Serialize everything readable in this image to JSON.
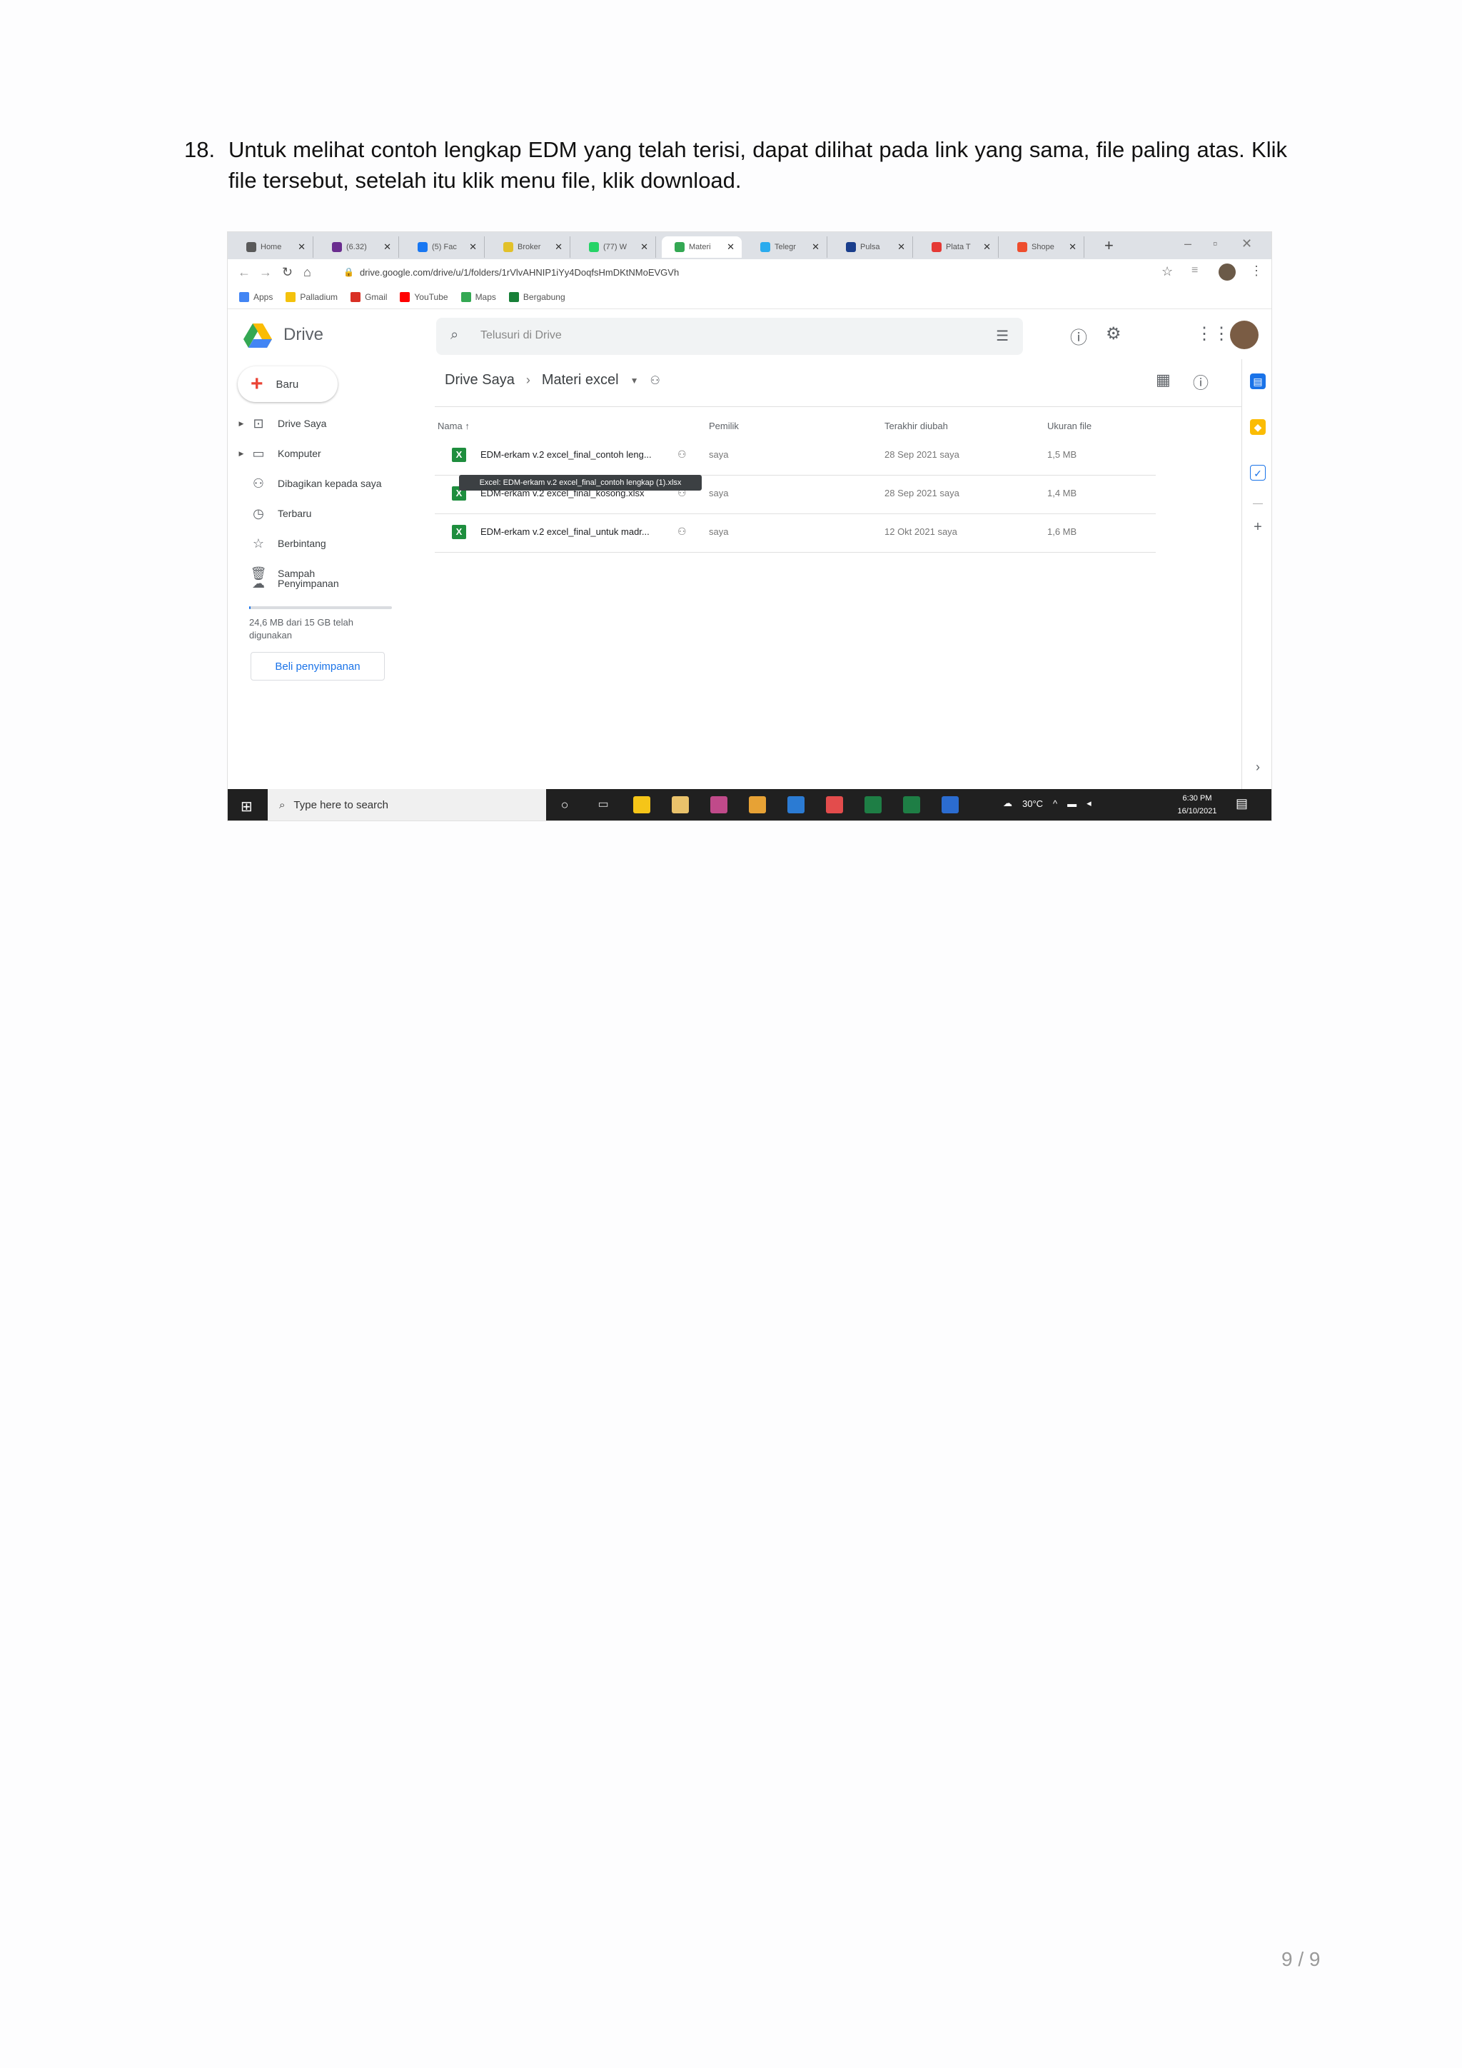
{
  "instruction": {
    "number": "18.",
    "text": "Untuk melihat contoh lengkap EDM yang telah terisi, dapat dilihat pada link yang sama, file paling atas. Klik file tersebut, setelah itu klik menu file, klik download."
  },
  "browser": {
    "tabs": [
      {
        "label": "Home",
        "color": "#5a5a5a"
      },
      {
        "label": "(6.32)",
        "color": "#6a2d8f"
      },
      {
        "label": "(5) Fac",
        "color": "#1877f2"
      },
      {
        "label": "Broker",
        "color": "#e2c12a"
      },
      {
        "label": "(77) W",
        "color": "#25d366"
      },
      {
        "label": "Materi",
        "color": "#34a853",
        "active": true
      },
      {
        "label": "Telegr",
        "color": "#2aabee"
      },
      {
        "label": "Pulsa",
        "color": "#1a3e8c"
      },
      {
        "label": "Plata T",
        "color": "#e53935"
      },
      {
        "label": "Shope",
        "color": "#ee4d2d"
      }
    ],
    "new_tab": "+",
    "url": "drive.google.com/drive/u/1/folders/1rVlvAHNIP1iYy4DoqfsHmDKtNMoEVGVh",
    "bookmarks": [
      {
        "label": "Apps",
        "color": "#4285f4"
      },
      {
        "label": "Palladium",
        "color": "#f4c20d"
      },
      {
        "label": "Gmail",
        "color": "#d93025"
      },
      {
        "label": "YouTube",
        "color": "#ff0000"
      },
      {
        "label": "Maps",
        "color": "#34a853"
      },
      {
        "label": "Bergabung",
        "color": "#188038"
      }
    ]
  },
  "drive": {
    "logo_text": "Drive",
    "search_placeholder": "Telusuri di Drive",
    "new_button": "Baru",
    "nav": [
      {
        "label": "Drive Saya",
        "icon": "drive-icon",
        "glyph": "⊡",
        "arrow": true
      },
      {
        "label": "Komputer",
        "icon": "computer-icon",
        "glyph": "▭",
        "arrow": true
      },
      {
        "label": "Dibagikan kepada saya",
        "icon": "shared-icon",
        "glyph": "⚇",
        "arrow": false
      },
      {
        "label": "Terbaru",
        "icon": "clock-icon",
        "glyph": "◷",
        "arrow": false
      },
      {
        "label": "Berbintang",
        "icon": "star-icon",
        "glyph": "☆",
        "arrow": false
      },
      {
        "label": "Sampah",
        "icon": "trash-icon",
        "glyph": "🗑",
        "arrow": false
      }
    ],
    "storage_label": "Penyimpanan",
    "storage_used": "24,6 MB dari 15 GB telah digunakan",
    "storage_fraction": 0.0016,
    "buy_storage": "Beli penyimpanan",
    "breadcrumb": {
      "root": "Drive Saya",
      "current": "Materi excel"
    },
    "columns": {
      "name": "Nama",
      "owner": "Pemilik",
      "modified": "Terakhir diubah",
      "size": "Ukuran file"
    },
    "files": [
      {
        "name": "EDM-erkam v.2 excel_final_contoh leng...",
        "owner": "saya",
        "modified": "28 Sep 2021 saya",
        "size": "1,5 MB"
      },
      {
        "name": "EDM-erkam v.2 excel_final_kosong.xlsx",
        "owner": "saya",
        "modified": "28 Sep 2021 saya",
        "size": "1,4 MB"
      },
      {
        "name": "EDM-erkam v.2 excel_final_untuk madr...",
        "owner": "saya",
        "modified": "12 Okt 2021 saya",
        "size": "1,6 MB"
      }
    ],
    "tooltip": "Excel: EDM-erkam v.2 excel_final_contoh lengkap (1).xlsx"
  },
  "taskbar": {
    "search_placeholder": "Type here to search",
    "temperature": "30°C",
    "time": "6:30 PM",
    "date": "16/10/2021"
  },
  "page_number": "9 / 9"
}
